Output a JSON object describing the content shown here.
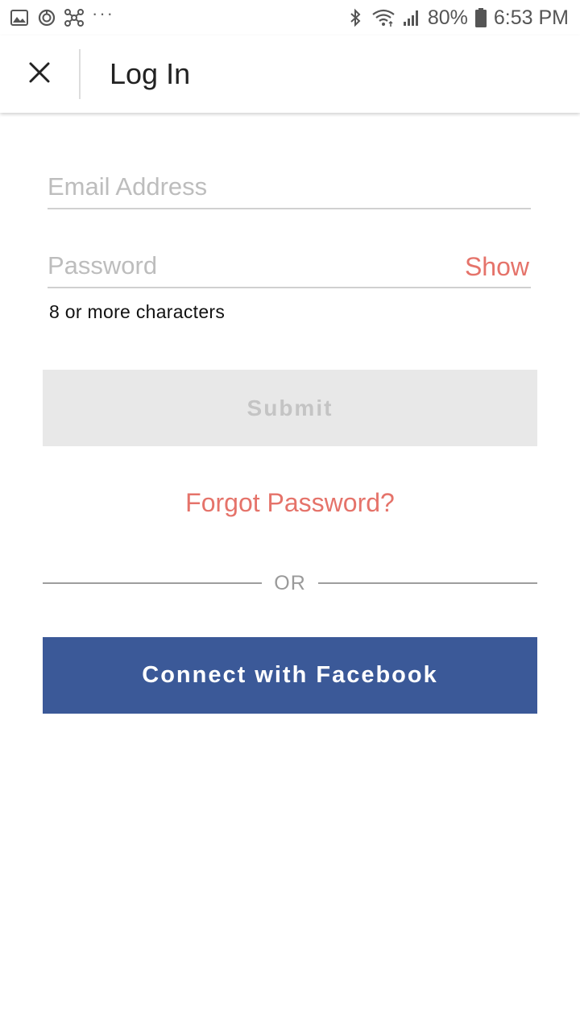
{
  "status_bar": {
    "left_icons": [
      "image-icon",
      "timer-sync-icon",
      "hub-icon",
      "more-notifications-icon"
    ],
    "more_label": "···",
    "right_icons": [
      "bluetooth-icon",
      "wifi-icon",
      "signal-icon"
    ],
    "battery": "80%",
    "time": "6:53 PM"
  },
  "header": {
    "close_icon": "close-icon",
    "title": "Log In"
  },
  "form": {
    "email": {
      "placeholder": "Email Address",
      "value": ""
    },
    "password": {
      "placeholder": "Password",
      "value": "",
      "toggle_label": "Show"
    },
    "password_hint": "8 or more characters",
    "submit_label": "Submit",
    "forgot_label": "Forgot Password?",
    "or_label": "OR",
    "facebook_label": "Connect with Facebook"
  },
  "colors": {
    "accent": "#e5736a",
    "facebook": "#3b5998",
    "submit_disabled_bg": "#e8e8e8",
    "submit_disabled_text": "#c4c4c4"
  }
}
